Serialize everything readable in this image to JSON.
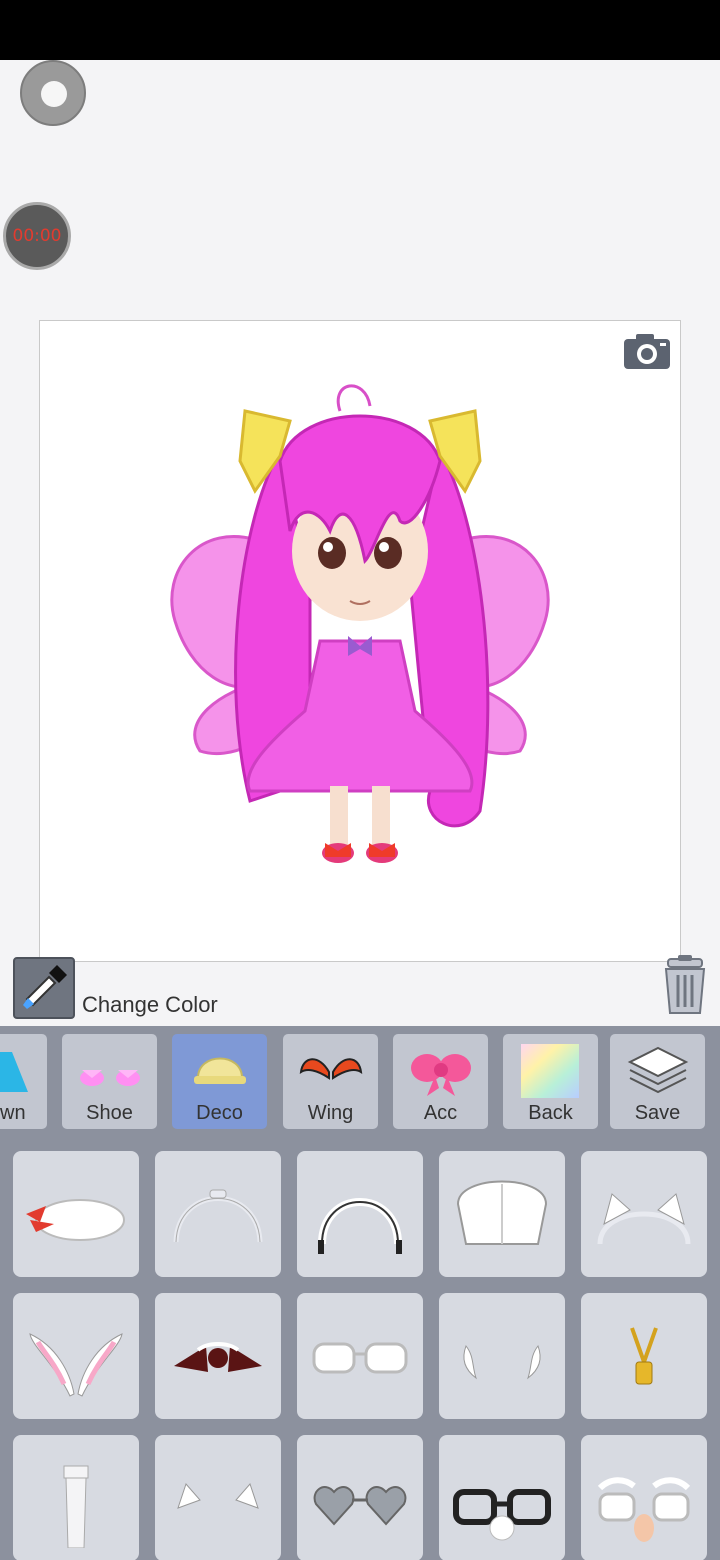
{
  "recorder": {
    "timer_text": "00:00"
  },
  "canvas": {
    "camera_icon": "camera-icon",
    "character": "chibi-fairy-character"
  },
  "color_row": {
    "change_color_label": "Change Color",
    "dropper_icon": "eyedropper-icon",
    "trash_icon": "trash-icon"
  },
  "tabs": [
    {
      "label": "wn",
      "icon": "skirt-icon"
    },
    {
      "label": "Shoe",
      "icon": "shoe-icon"
    },
    {
      "label": "Deco",
      "icon": "cap-icon",
      "active": true
    },
    {
      "label": "Wing",
      "icon": "wing-icon"
    },
    {
      "label": "Acc",
      "icon": "bow-icon"
    },
    {
      "label": "Back",
      "icon": "rainbow-icon"
    },
    {
      "label": "Save",
      "icon": "layers-icon"
    }
  ],
  "colors": {
    "active_tab": "#7f99d6",
    "tab_bg": "#c2c6d0",
    "panel_bg": "#8c919e",
    "hair": "#ee3fe0"
  },
  "items": [
    "white-cap-red-ribbon-icon",
    "headband-icon",
    "maid-headband-icon",
    "baseball-cap-icon",
    "cat-ears-headband-icon",
    "bunny-ears-icon",
    "bat-bow-headpiece-icon",
    "glasses-icon",
    "small-horns-icon",
    "gold-necklace-icon",
    "tie-icon",
    "small-cat-ears-icon",
    "heart-sunglasses-icon",
    "nose-glasses-icon",
    "groucho-glasses-icon"
  ]
}
